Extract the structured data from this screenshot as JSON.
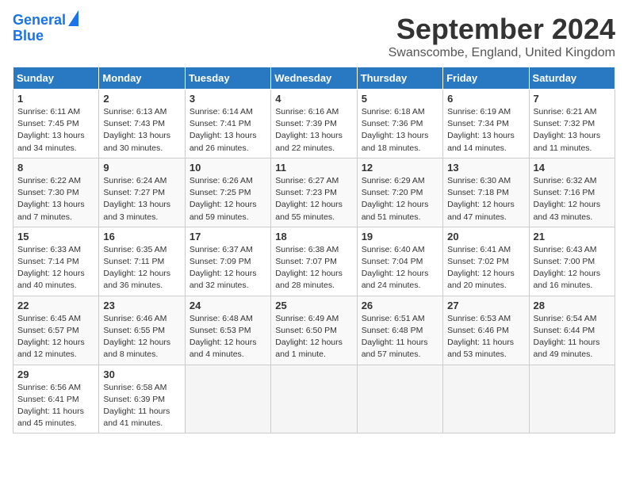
{
  "logo": {
    "line1": "General",
    "line2": "Blue"
  },
  "title": "September 2024",
  "subtitle": "Swanscombe, England, United Kingdom",
  "days_of_week": [
    "Sunday",
    "Monday",
    "Tuesday",
    "Wednesday",
    "Thursday",
    "Friday",
    "Saturday"
  ],
  "weeks": [
    [
      {
        "day": "1",
        "sunrise": "6:11 AM",
        "sunset": "7:45 PM",
        "daylight": "13 hours and 34 minutes."
      },
      {
        "day": "2",
        "sunrise": "6:13 AM",
        "sunset": "7:43 PM",
        "daylight": "13 hours and 30 minutes."
      },
      {
        "day": "3",
        "sunrise": "6:14 AM",
        "sunset": "7:41 PM",
        "daylight": "13 hours and 26 minutes."
      },
      {
        "day": "4",
        "sunrise": "6:16 AM",
        "sunset": "7:39 PM",
        "daylight": "13 hours and 22 minutes."
      },
      {
        "day": "5",
        "sunrise": "6:18 AM",
        "sunset": "7:36 PM",
        "daylight": "13 hours and 18 minutes."
      },
      {
        "day": "6",
        "sunrise": "6:19 AM",
        "sunset": "7:34 PM",
        "daylight": "13 hours and 14 minutes."
      },
      {
        "day": "7",
        "sunrise": "6:21 AM",
        "sunset": "7:32 PM",
        "daylight": "13 hours and 11 minutes."
      }
    ],
    [
      {
        "day": "8",
        "sunrise": "6:22 AM",
        "sunset": "7:30 PM",
        "daylight": "13 hours and 7 minutes."
      },
      {
        "day": "9",
        "sunrise": "6:24 AM",
        "sunset": "7:27 PM",
        "daylight": "13 hours and 3 minutes."
      },
      {
        "day": "10",
        "sunrise": "6:26 AM",
        "sunset": "7:25 PM",
        "daylight": "12 hours and 59 minutes."
      },
      {
        "day": "11",
        "sunrise": "6:27 AM",
        "sunset": "7:23 PM",
        "daylight": "12 hours and 55 minutes."
      },
      {
        "day": "12",
        "sunrise": "6:29 AM",
        "sunset": "7:20 PM",
        "daylight": "12 hours and 51 minutes."
      },
      {
        "day": "13",
        "sunrise": "6:30 AM",
        "sunset": "7:18 PM",
        "daylight": "12 hours and 47 minutes."
      },
      {
        "day": "14",
        "sunrise": "6:32 AM",
        "sunset": "7:16 PM",
        "daylight": "12 hours and 43 minutes."
      }
    ],
    [
      {
        "day": "15",
        "sunrise": "6:33 AM",
        "sunset": "7:14 PM",
        "daylight": "12 hours and 40 minutes."
      },
      {
        "day": "16",
        "sunrise": "6:35 AM",
        "sunset": "7:11 PM",
        "daylight": "12 hours and 36 minutes."
      },
      {
        "day": "17",
        "sunrise": "6:37 AM",
        "sunset": "7:09 PM",
        "daylight": "12 hours and 32 minutes."
      },
      {
        "day": "18",
        "sunrise": "6:38 AM",
        "sunset": "7:07 PM",
        "daylight": "12 hours and 28 minutes."
      },
      {
        "day": "19",
        "sunrise": "6:40 AM",
        "sunset": "7:04 PM",
        "daylight": "12 hours and 24 minutes."
      },
      {
        "day": "20",
        "sunrise": "6:41 AM",
        "sunset": "7:02 PM",
        "daylight": "12 hours and 20 minutes."
      },
      {
        "day": "21",
        "sunrise": "6:43 AM",
        "sunset": "7:00 PM",
        "daylight": "12 hours and 16 minutes."
      }
    ],
    [
      {
        "day": "22",
        "sunrise": "6:45 AM",
        "sunset": "6:57 PM",
        "daylight": "12 hours and 12 minutes."
      },
      {
        "day": "23",
        "sunrise": "6:46 AM",
        "sunset": "6:55 PM",
        "daylight": "12 hours and 8 minutes."
      },
      {
        "day": "24",
        "sunrise": "6:48 AM",
        "sunset": "6:53 PM",
        "daylight": "12 hours and 4 minutes."
      },
      {
        "day": "25",
        "sunrise": "6:49 AM",
        "sunset": "6:50 PM",
        "daylight": "12 hours and 1 minute."
      },
      {
        "day": "26",
        "sunrise": "6:51 AM",
        "sunset": "6:48 PM",
        "daylight": "11 hours and 57 minutes."
      },
      {
        "day": "27",
        "sunrise": "6:53 AM",
        "sunset": "6:46 PM",
        "daylight": "11 hours and 53 minutes."
      },
      {
        "day": "28",
        "sunrise": "6:54 AM",
        "sunset": "6:44 PM",
        "daylight": "11 hours and 49 minutes."
      }
    ],
    [
      {
        "day": "29",
        "sunrise": "6:56 AM",
        "sunset": "6:41 PM",
        "daylight": "11 hours and 45 minutes."
      },
      {
        "day": "30",
        "sunrise": "6:58 AM",
        "sunset": "6:39 PM",
        "daylight": "11 hours and 41 minutes."
      },
      null,
      null,
      null,
      null,
      null
    ]
  ]
}
